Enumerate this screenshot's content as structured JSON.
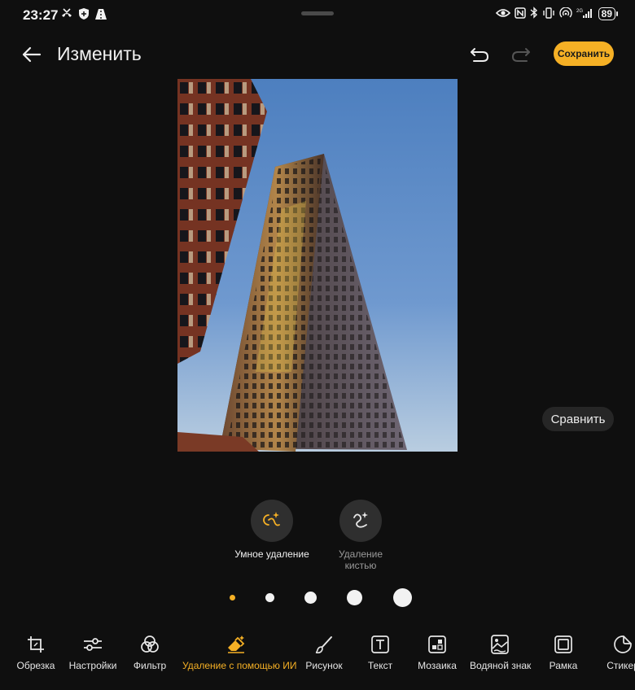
{
  "status_bar": {
    "time": "23:27",
    "network_label": "2₄₆",
    "battery": "89"
  },
  "header": {
    "title": "Изменить",
    "save_label": "Сохранить"
  },
  "compare_label": "Сравнить",
  "removal_options": [
    {
      "label": "Умное удаление",
      "selected": true
    },
    {
      "label": "Удаление кистью",
      "selected": false
    }
  ],
  "brush_sizes": {
    "count": 5,
    "selected_index": 0
  },
  "toolbar": [
    {
      "label": "Обрезка",
      "icon": "crop-icon"
    },
    {
      "label": "Настройки",
      "icon": "sliders-icon"
    },
    {
      "label": "Фильтр",
      "icon": "filter-icon"
    },
    {
      "label": "Удаление с помощью ИИ",
      "icon": "ai-eraser-icon",
      "active": true
    },
    {
      "label": "Рисунок",
      "icon": "brush-icon"
    },
    {
      "label": "Текст",
      "icon": "text-icon"
    },
    {
      "label": "Мозаика",
      "icon": "mosaic-icon"
    },
    {
      "label": "Водяной знак",
      "icon": "watermark-icon"
    },
    {
      "label": "Рамка",
      "icon": "frame-icon"
    },
    {
      "label": "Стикер",
      "icon": "sticker-icon"
    }
  ],
  "colors": {
    "accent": "#f5b025",
    "background": "#0f0f0f"
  }
}
